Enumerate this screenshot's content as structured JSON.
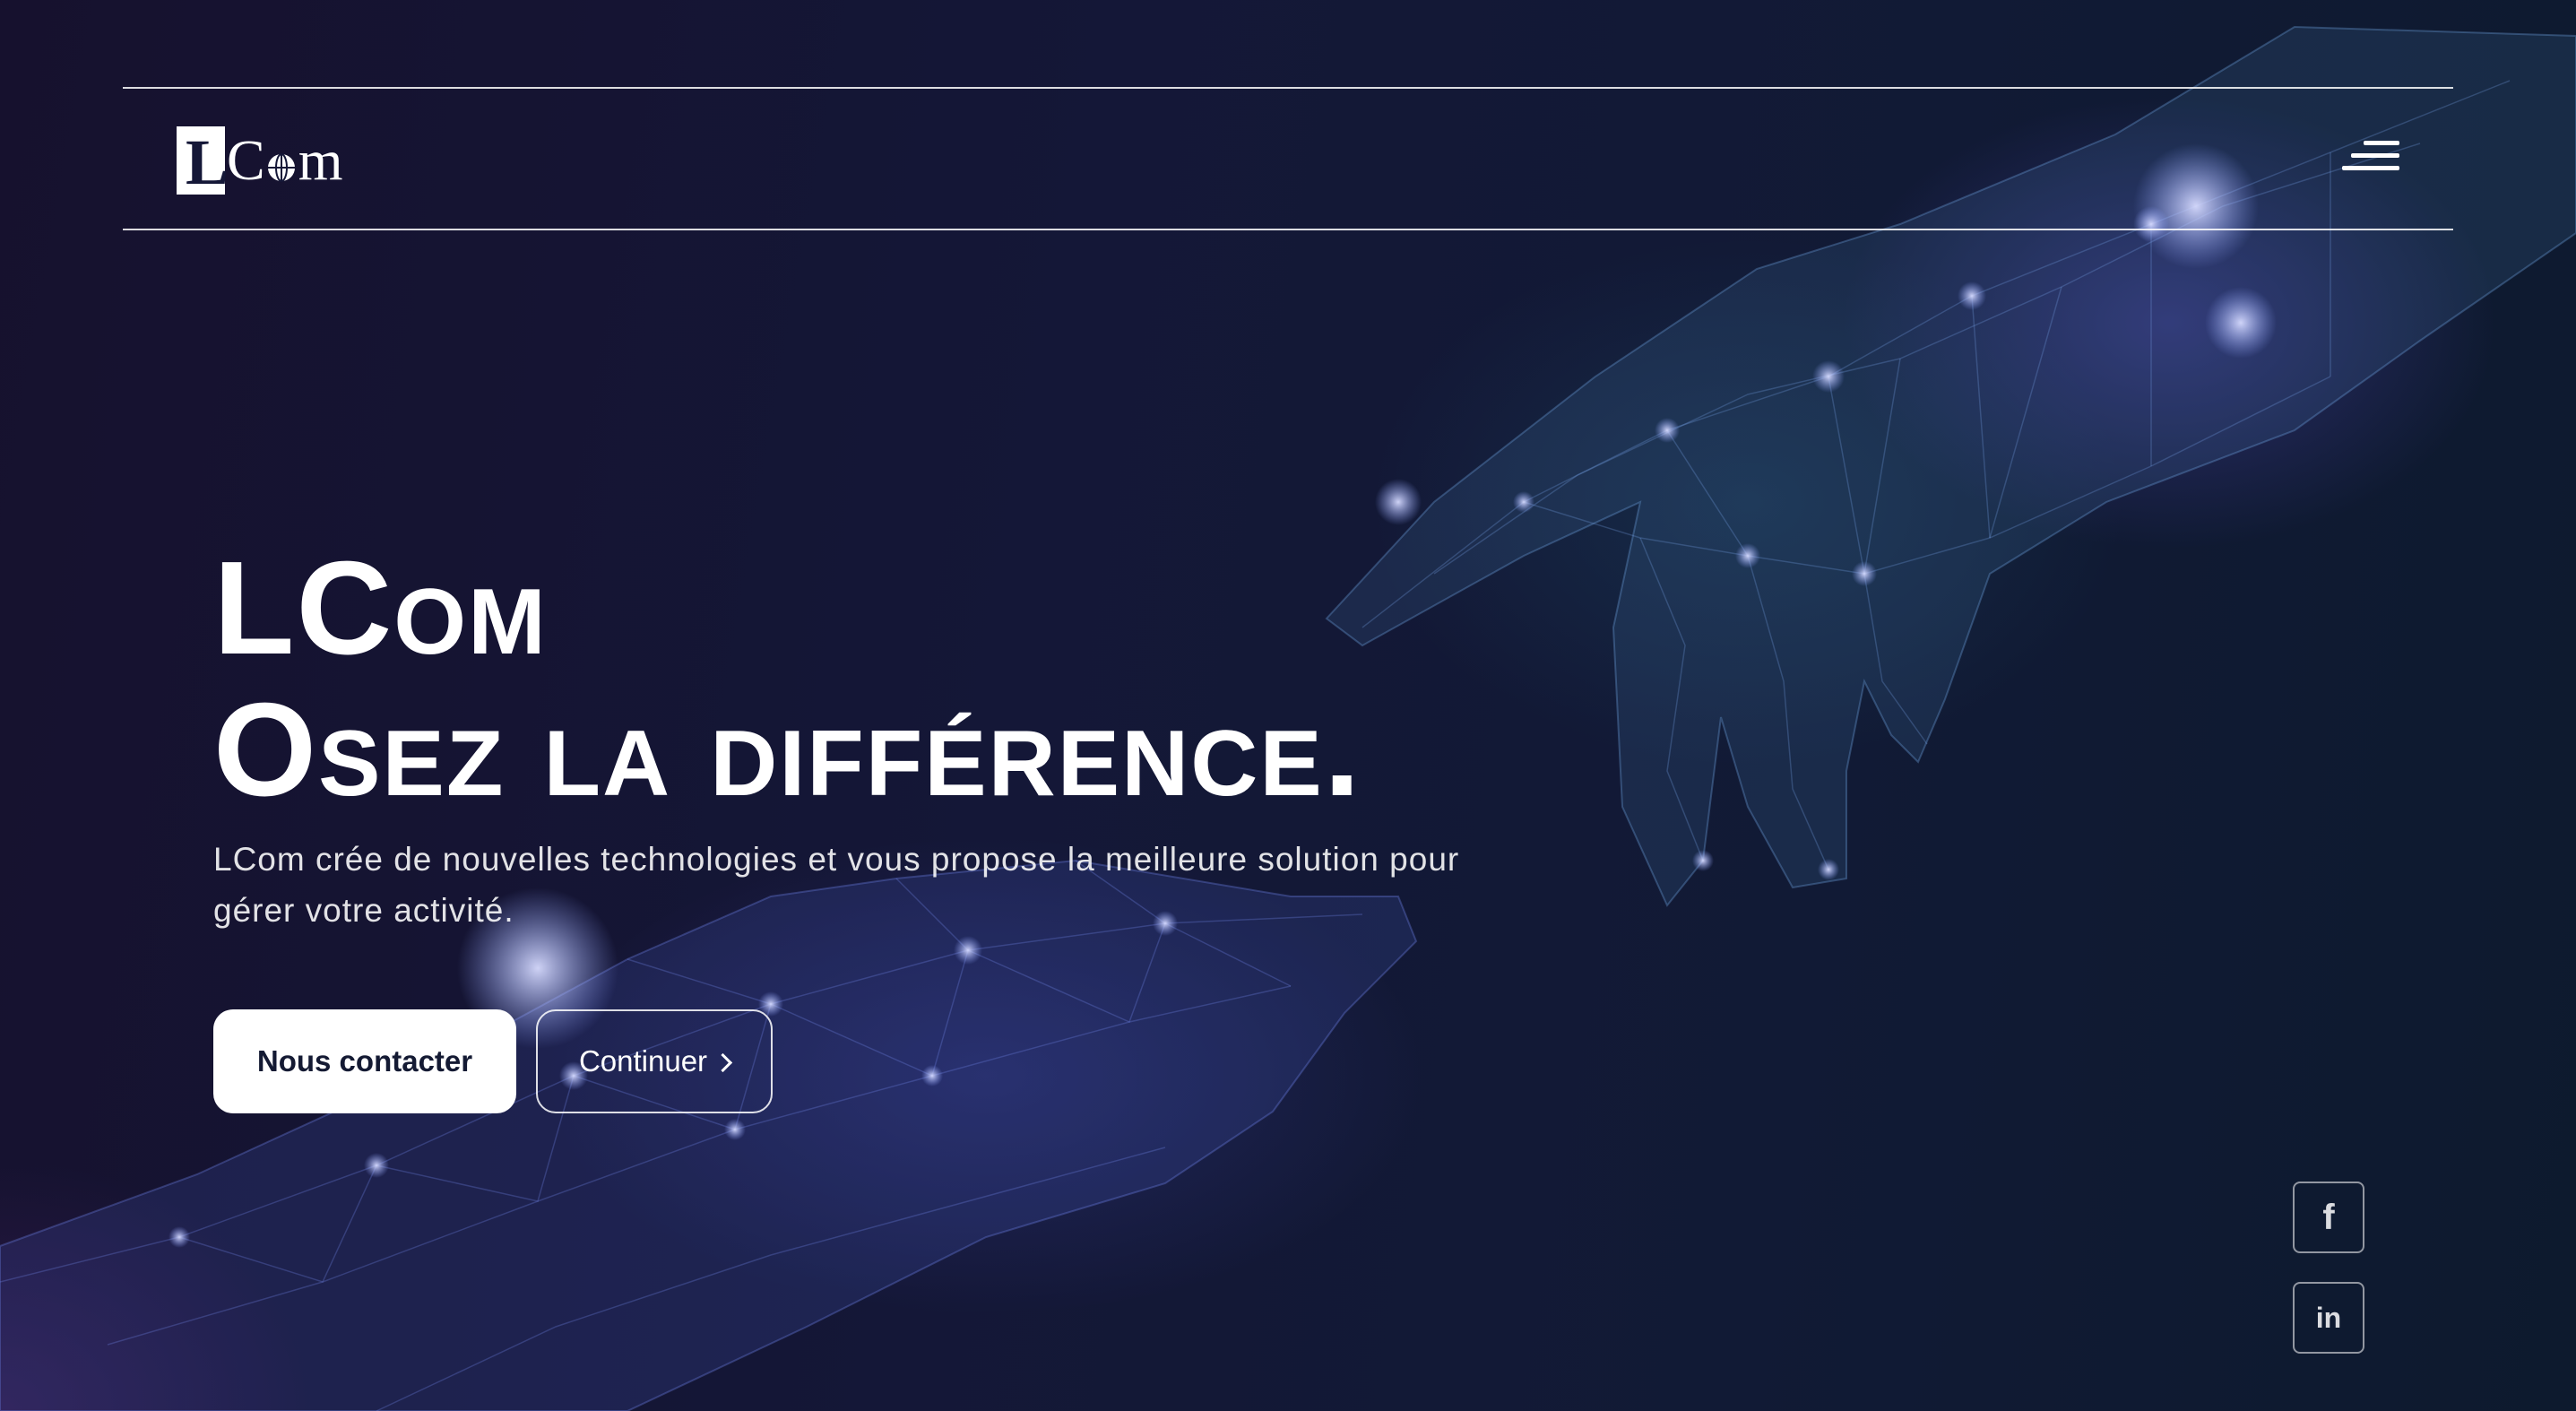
{
  "header": {
    "logo": {
      "box_letter": "L",
      "text_start": "C",
      "text_end": "m"
    },
    "menu_icon": "hamburger-menu-icon"
  },
  "hero": {
    "title_line1": "LCom",
    "title_line2": "Osez la différence.",
    "description": "LCom crée de nouvelles technologies et vous propose la meilleure solution pour gérer votre activité."
  },
  "buttons": {
    "contact_label": "Nous contacter",
    "continue_label": "Continuer",
    "continue_icon": "chevron-right-icon"
  },
  "social": {
    "facebook_glyph": "f",
    "linkedin_glyph": "in"
  },
  "colors": {
    "background": "#131733",
    "accent_glow": "#6052d2",
    "text": "#ffffff",
    "primary_button_text": "#141a33"
  }
}
